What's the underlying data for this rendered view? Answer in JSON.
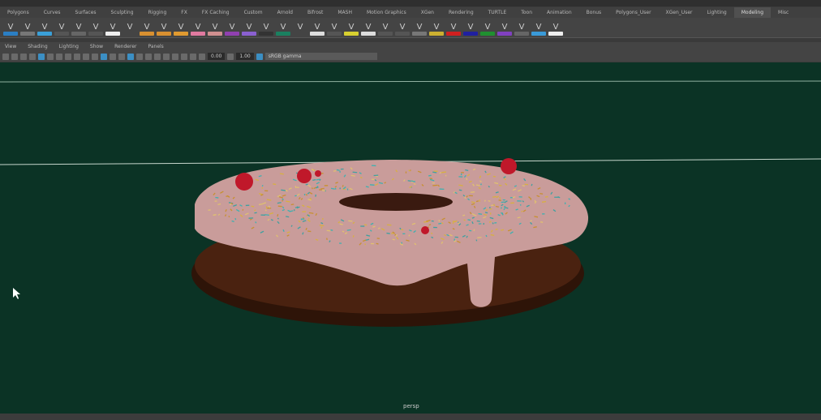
{
  "shelf_tabs": [
    "Polygons",
    "Curves",
    "Surfaces",
    "Sculpting",
    "Rigging",
    "FX",
    "FX Caching",
    "Custom",
    "Arnold",
    "Bifrost",
    "MASH",
    "Motion Graphics",
    "XGen",
    "Rendering",
    "TURTLE",
    "Toon",
    "Animation",
    "Bonus",
    "Polygons_User",
    "XGen_User",
    "Lighting",
    "Modeling",
    "Misc"
  ],
  "active_shelf_tab": "Modeling",
  "shelf_icon_colors": [
    "#2b7fc4",
    "#777",
    "#3aa0d8",
    "#555",
    "#666",
    "#555",
    "#eee",
    "#444",
    "#d89030",
    "#d89030",
    "#e09a30",
    "#e07aa0",
    "#d09090",
    "#9040b0",
    "#8a60d0",
    "#333",
    "#1a8060",
    "#444",
    "#ddd",
    "#555",
    "#d8d030",
    "#ddd",
    "#555",
    "#555",
    "#777",
    "#ccb030",
    "#d02020",
    "#2020a0",
    "#209030",
    "#8040c0",
    "#666",
    "#3a9ad8",
    "#eee"
  ],
  "viewport_menu": [
    "View",
    "Shading",
    "Lighting",
    "Show",
    "Renderer",
    "Panels"
  ],
  "toolbar_values": {
    "value1": "0.00",
    "value2": "1.00",
    "colorspace": "sRGB gamma"
  },
  "camera_label": "persp",
  "colors": {
    "viewport_bg": "#0b3325",
    "glaze": "#c99a98",
    "dough": "#3b1a0c",
    "cherry": "#c0182a"
  }
}
